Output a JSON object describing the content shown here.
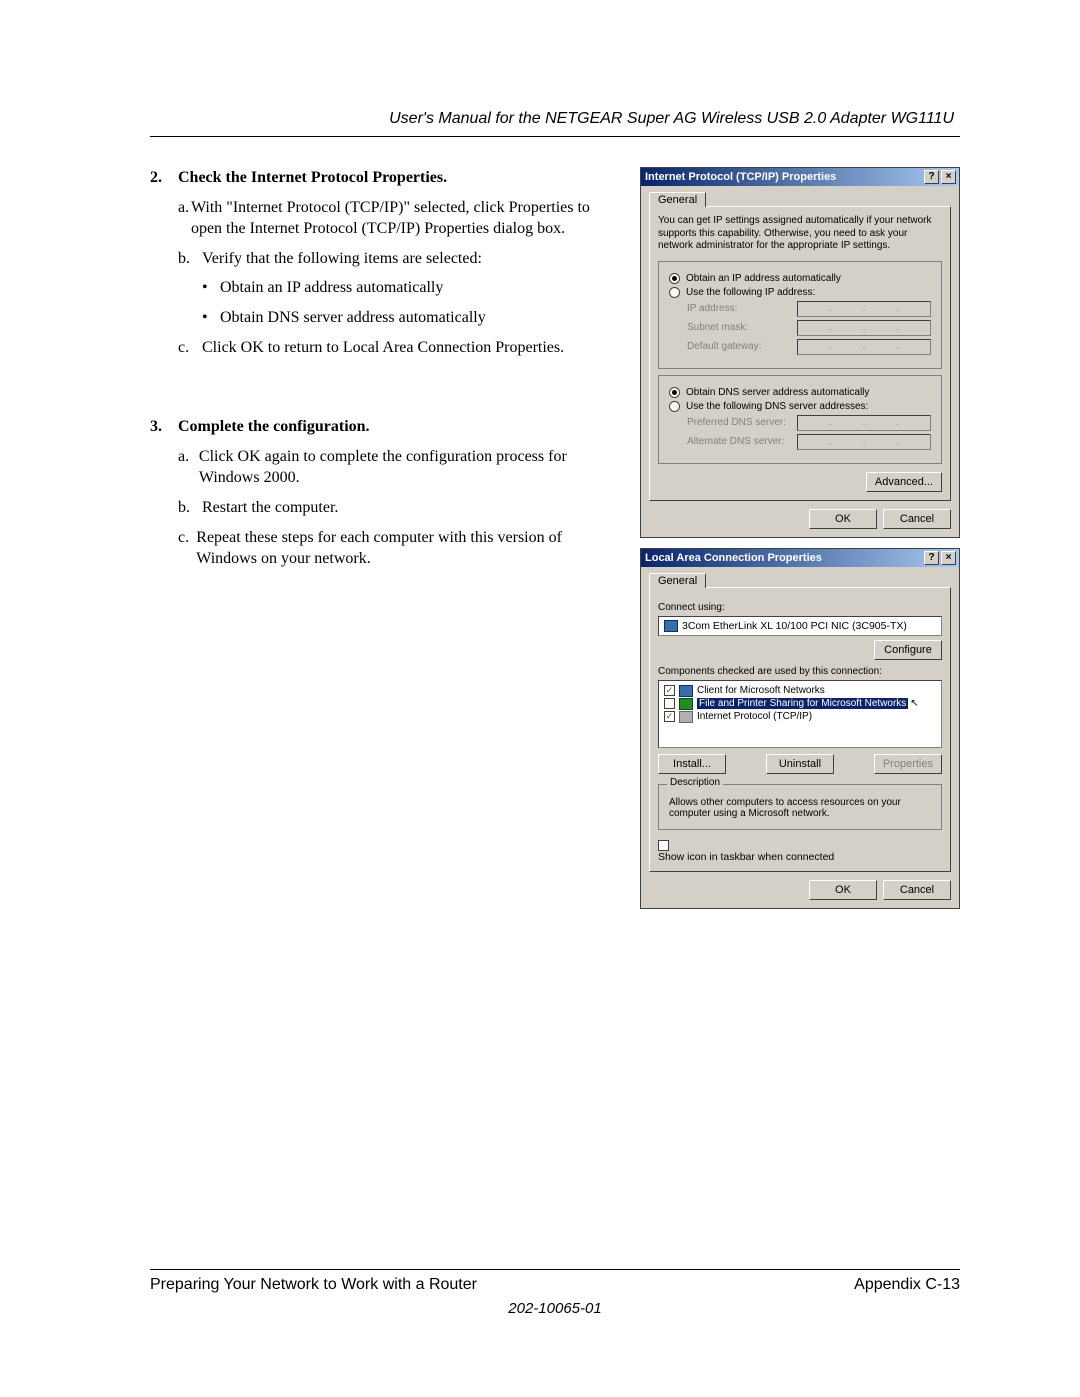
{
  "header": {
    "title": "User's Manual for the NETGEAR Super AG Wireless USB 2.0 Adapter WG111U"
  },
  "steps": [
    {
      "num": "2.",
      "title": "Check the Internet Protocol Properties.",
      "subs": [
        {
          "letter": "a.",
          "text": "With \"Internet Protocol (TCP/IP)\" selected, click Properties to open the Internet Protocol (TCP/IP) Properties dialog box."
        },
        {
          "letter": "b.",
          "text": "Verify that the following items are selected:",
          "bullets": [
            "Obtain an IP address automatically",
            "Obtain DNS server address automatically"
          ]
        },
        {
          "letter": "c.",
          "text": "Click OK to return to Local Area Connection Properties."
        }
      ]
    },
    {
      "num": "3.",
      "title": "Complete the configuration.",
      "subs": [
        {
          "letter": "a.",
          "text": "Click OK again to complete the configuration process for Windows 2000."
        },
        {
          "letter": "b.",
          "text": "Restart the computer."
        },
        {
          "letter": "c.",
          "text": "Repeat these steps for each computer with this version of Windows on your network."
        }
      ]
    }
  ],
  "dialog1": {
    "title": "Internet Protocol (TCP/IP) Properties",
    "help_btn": "?",
    "close_btn": "×",
    "tab": "General",
    "intro": "You can get IP settings assigned automatically if your network supports this capability. Otherwise, you need to ask your network administrator for the appropriate IP settings.",
    "radio_ip_auto": "Obtain an IP address automatically",
    "radio_ip_manual": "Use the following IP address:",
    "lbl_ip": "IP address:",
    "lbl_mask": "Subnet mask:",
    "lbl_gw": "Default gateway:",
    "radio_dns_auto": "Obtain DNS server address automatically",
    "radio_dns_manual": "Use the following DNS server addresses:",
    "lbl_pref_dns": "Preferred DNS server:",
    "lbl_alt_dns": "Alternate DNS server:",
    "btn_advanced": "Advanced...",
    "btn_ok": "OK",
    "btn_cancel": "Cancel"
  },
  "dialog2": {
    "title": "Local Area Connection Properties",
    "help_btn": "?",
    "close_btn": "×",
    "tab": "General",
    "lbl_connect_using": "Connect using:",
    "adapter": "3Com EtherLink XL 10/100 PCI NIC (3C905-TX)",
    "btn_configure": "Configure",
    "lbl_components": "Components checked are used by this connection:",
    "components": [
      {
        "checked": true,
        "label": "Client for Microsoft Networks",
        "selected": false,
        "color": "blue"
      },
      {
        "checked": false,
        "label": "File and Printer Sharing for Microsoft Networks",
        "selected": true,
        "color": "green"
      },
      {
        "checked": true,
        "label": "Internet Protocol (TCP/IP)",
        "selected": false,
        "color": "net"
      }
    ],
    "btn_install": "Install...",
    "btn_uninstall": "Uninstall",
    "btn_properties": "Properties",
    "grp_desc_title": "Description",
    "desc_text": "Allows other computers to access resources on your computer using a Microsoft network.",
    "chk_show_icon": "Show icon in taskbar when connected",
    "btn_ok": "OK",
    "btn_cancel": "Cancel"
  },
  "footer": {
    "left": "Preparing Your Network to Work with a Router",
    "right": "Appendix C-13",
    "docnum": "202-10065-01"
  }
}
